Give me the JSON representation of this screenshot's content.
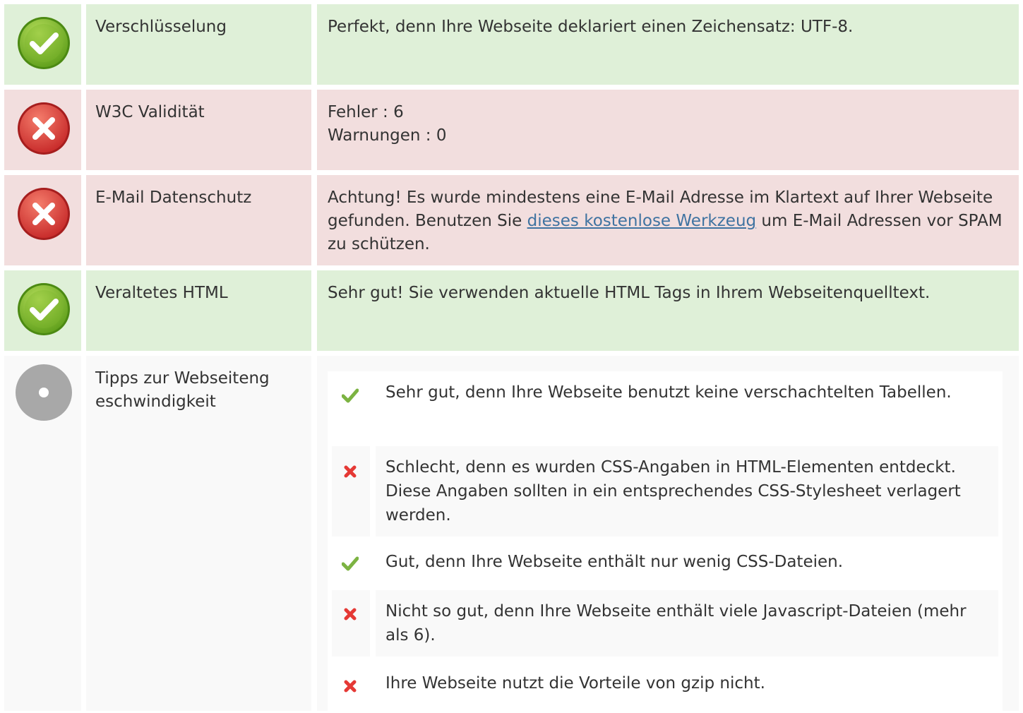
{
  "rows": [
    {
      "status": "good",
      "label": "Verschlüsselung",
      "text": "Perfekt, denn Ihre Webseite deklariert einen Zeichensatz: UTF-8."
    },
    {
      "status": "bad",
      "label": "W3C Validität",
      "line1": "Fehler : 6",
      "line2": "Warnungen : 0"
    },
    {
      "status": "bad",
      "label": "E-Mail Datenschutz",
      "text_before": "Achtung! Es wurde mindestens eine E-Mail Adresse im Klartext auf Ihrer Webseite gefunden. Benutzen Sie ",
      "link": "dieses kostenlose Werkzeug",
      "text_after": " um E-Mail Adressen vor SPAM zu schützen."
    },
    {
      "status": "good",
      "label": "Veraltetes HTML",
      "text": "Sehr gut! Sie verwenden aktuelle HTML Tags in Ihrem Webseitenquelltext."
    },
    {
      "status": "neutral",
      "label": "Tipps zur Webseiteng eschwindigkeit",
      "tips": [
        {
          "status": "good",
          "text": "Sehr gut, denn Ihre Webseite benutzt keine verschachtelten Tabellen."
        },
        {
          "status": "bad",
          "text": "Schlecht, denn es wurden CSS-Angaben in HTML-Elementen entdeckt. Diese Angaben sollten in ein entsprechendes CSS-Stylesheet verlagert werden."
        },
        {
          "status": "good",
          "text": "Gut, denn Ihre Webseite enthält nur wenig CSS-Dateien."
        },
        {
          "status": "bad",
          "text": "Nicht so gut, denn Ihre Webseite enthält viele Javascript-Dateien (mehr als 6)."
        },
        {
          "status": "bad",
          "text": "Ihre Webseite nutzt die Vorteile von gzip nicht."
        }
      ]
    }
  ],
  "colors": {
    "good_bg": "#dff0d8",
    "bad_bg": "#f2dede",
    "neutral_bg": "#f9f9f9",
    "check_green": "#7cb342",
    "cross_red": "#e53935",
    "link_blue": "#3f73a1"
  },
  "icons": {
    "good": "check-circle-icon",
    "bad": "cross-circle-icon",
    "neutral": "info-circle-icon",
    "tip_good": "checkmark-icon",
    "tip_bad": "x-mark-icon"
  }
}
